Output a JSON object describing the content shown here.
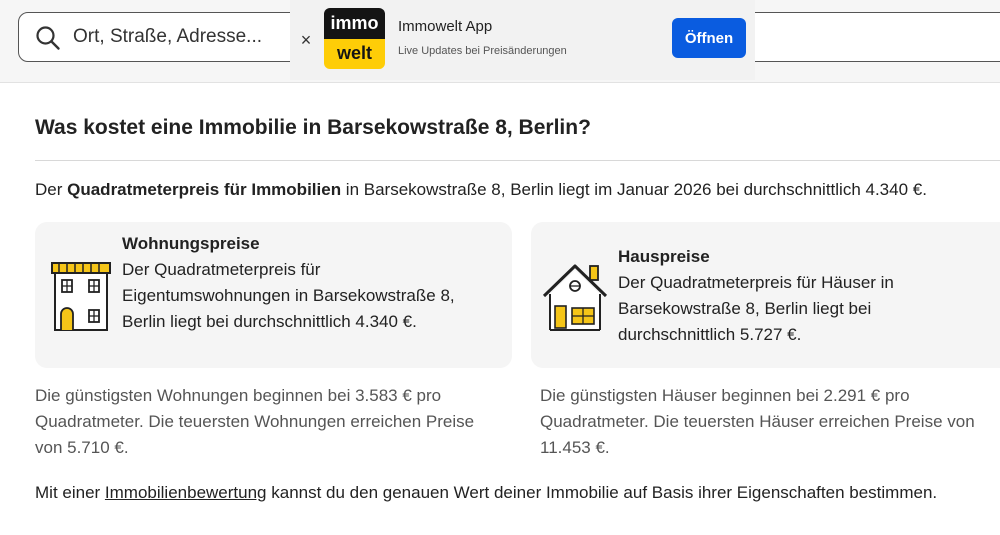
{
  "search": {
    "placeholder": "Ort, Straße, Adresse..."
  },
  "banner": {
    "logo_top": "immo",
    "logo_bottom": "welt",
    "title": "Immowelt App",
    "subtitle": "Live Updates bei Preisänderungen",
    "open_label": "Öffnen",
    "close_symbol": "×"
  },
  "heading": "Was kostet eine Immobilie in Barsekowstraße 8, Berlin?",
  "intro": {
    "prefix": "Der ",
    "bold": "Quadratmeterpreis für Immobilien",
    "suffix": " in Barsekowstraße 8, Berlin liegt im Januar 2026 bei durchschnittlich 4.340 €."
  },
  "apartments": {
    "title": "Wohnungspreise",
    "text": "Der Quadratmeterpreis für Eigentumswohnungen in Barsekowstraße 8, Berlin liegt bei durchschnittlich 4.340 €.",
    "range": "Die günstigsten Wohnungen beginnen bei 3.583 € pro Quadratmeter. Die teuersten Wohnungen erreichen Preise von 5.710 €."
  },
  "houses": {
    "title": "Hauspreise",
    "text": "Der Quadratmeterpreis für Häuser in Barsekowstraße 8, Berlin liegt bei durchschnittlich 5.727 €.",
    "range": "Die günstigsten Häuser beginnen bei 2.291 € pro Quadratmeter. Die teuersten Häuser erreichen Preise von 11.453 €."
  },
  "bottom": {
    "prefix": "Mit einer ",
    "link": "Immobilienbewertung",
    "suffix": " kannst du den genauen Wert deiner Immobilie auf Basis ihrer Eigenschaften bestimmen."
  },
  "colors": {
    "accent_button": "#0a5ce0",
    "logo_yellow": "#fecd07",
    "logo_black": "#141414",
    "icon_yellow": "#f5c518"
  },
  "icons": [
    "search-icon",
    "close-icon",
    "apartment-building-icon",
    "house-icon"
  ]
}
